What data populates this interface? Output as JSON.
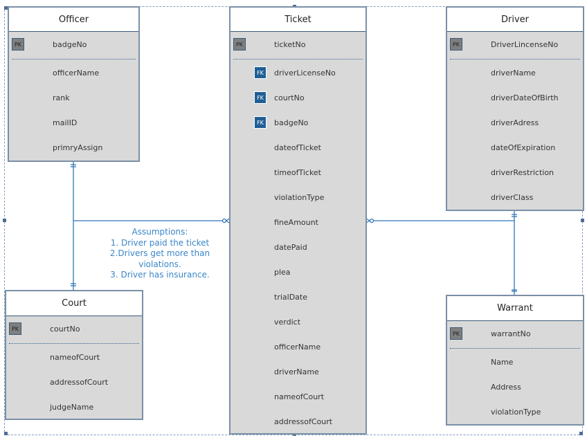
{
  "entities": [
    {
      "id": "officer",
      "title": "Officer",
      "pk": "badgeNo",
      "fks": [],
      "attributes": [
        "officerName",
        "rank",
        "mailID",
        "primryAssign"
      ]
    },
    {
      "id": "ticket",
      "title": "Ticket",
      "pk": "ticketNo",
      "fks": [
        "driverLicenseNo",
        "courtNo",
        "badgeNo"
      ],
      "attributes": [
        "dateofTicket",
        "timeofTicket",
        "violationType",
        "fineAmount",
        "datePaid",
        "plea",
        "trialDate",
        "verdict",
        "officerName",
        "driverName",
        "nameofCourt",
        "addressofCourt"
      ]
    },
    {
      "id": "driver",
      "title": "Driver",
      "pk": "DriverLincenseNo",
      "fks": [],
      "attributes": [
        "driverName",
        "driverDateOfBirth",
        "driverAdress",
        "dateOfExpiration",
        "driverRestriction",
        "driverClass"
      ]
    },
    {
      "id": "court",
      "title": "Court",
      "pk": "courtNo",
      "fks": [],
      "attributes": [
        "nameofCourt",
        "addressofCourt",
        "judgeName"
      ]
    },
    {
      "id": "warrant",
      "title": "Warrant",
      "pk": "warrantNo",
      "fks": [],
      "attributes": [
        "Name",
        "Address",
        "violationType"
      ]
    }
  ],
  "key_labels": {
    "pk": "PK",
    "fk": "FK"
  },
  "note": {
    "lines": [
      "Assumptions:",
      "1. Driver paid the ticket",
      "2.Drivers get more than",
      "violations.",
      "3. Driver has insurance."
    ]
  },
  "colors": {
    "line": "#2e75b6",
    "note": "#3a86c8",
    "fk": "#1f5f96",
    "pk": "#7f7f7f",
    "body": "#d9d9d9"
  }
}
